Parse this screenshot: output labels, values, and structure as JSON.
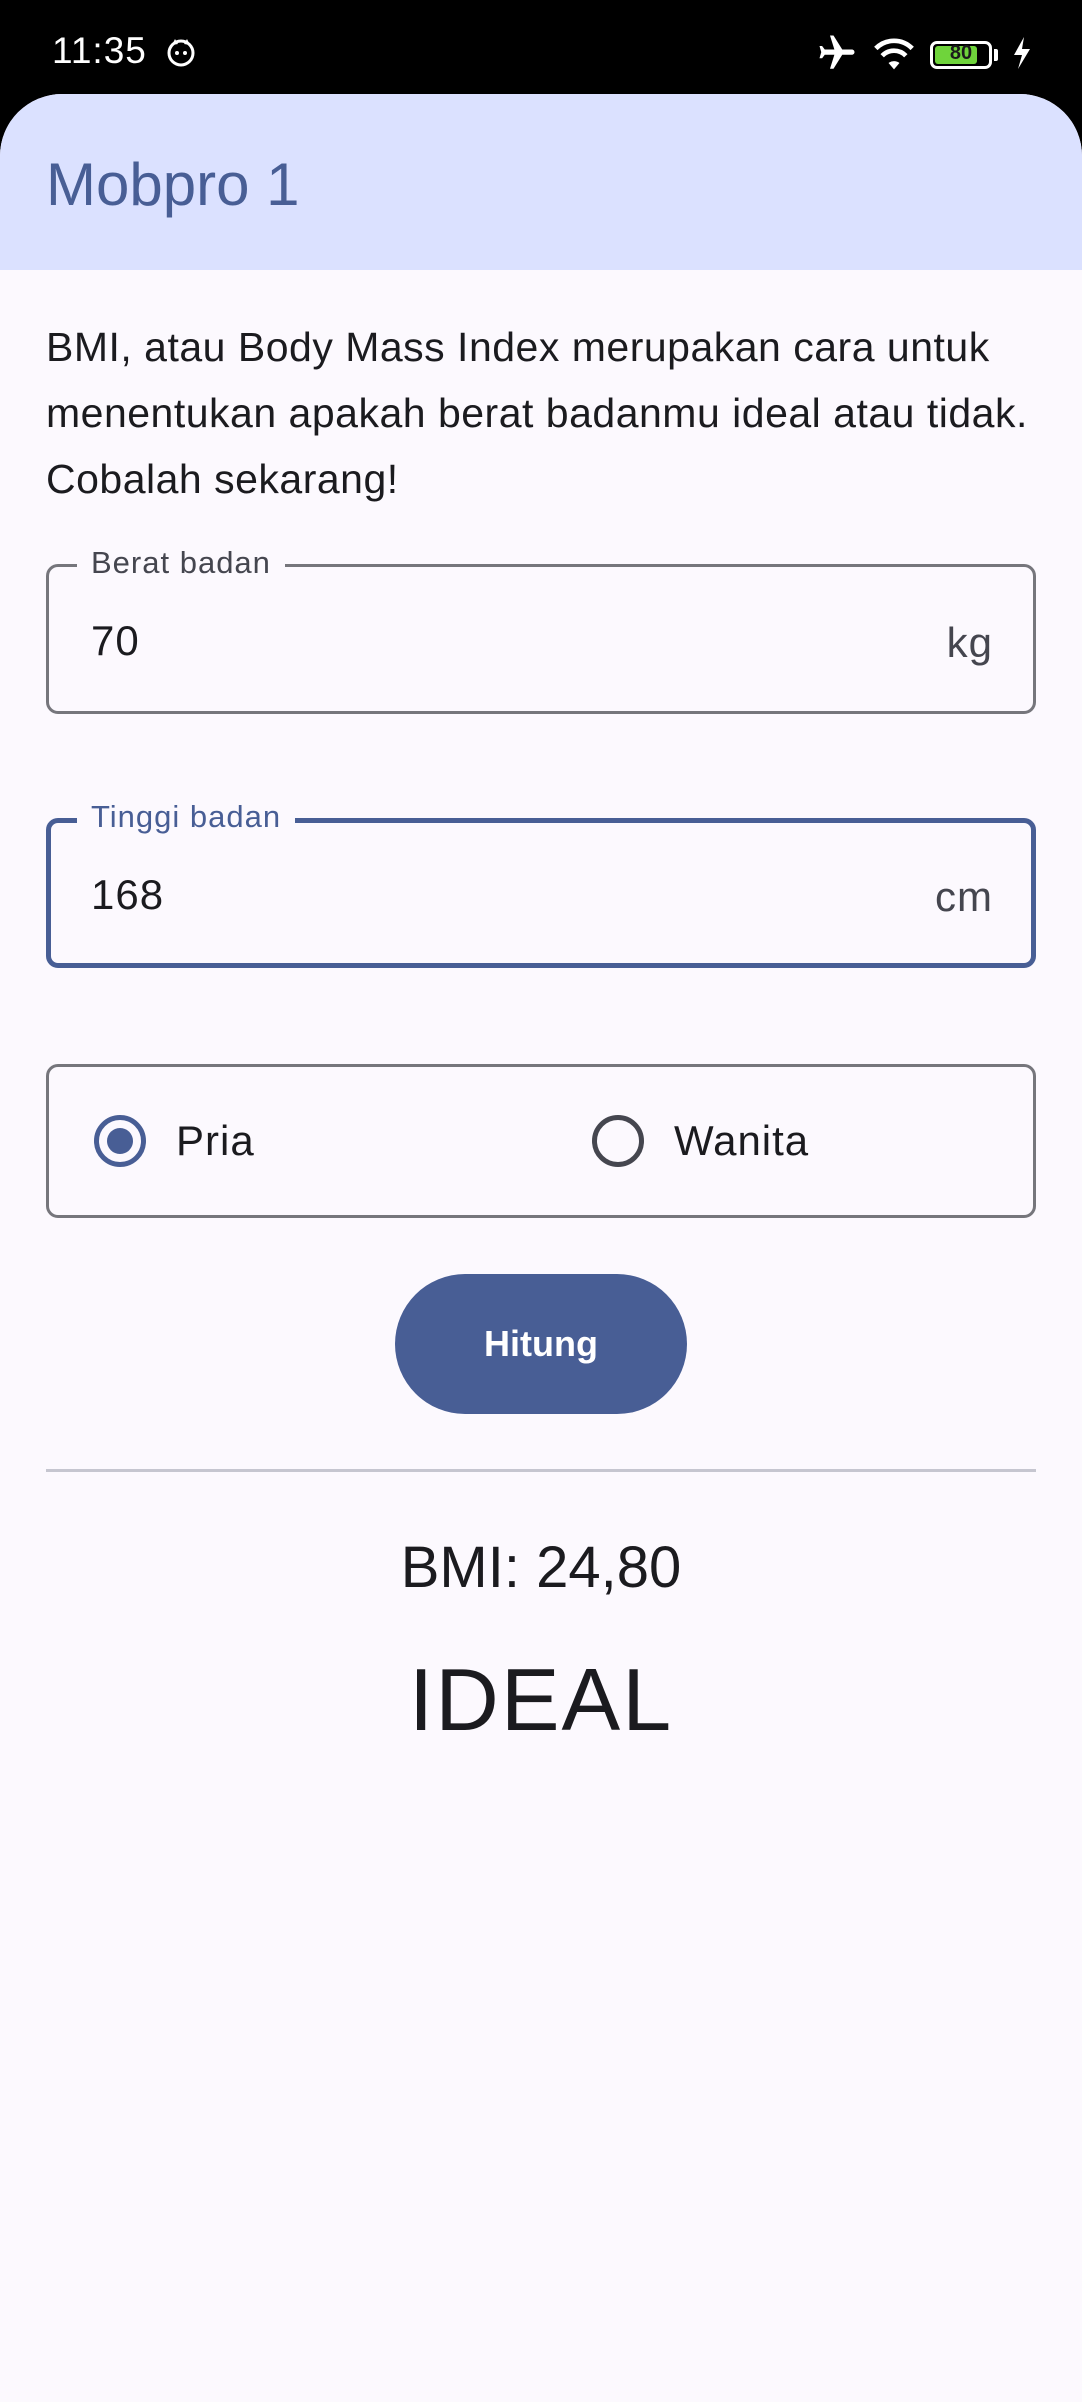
{
  "status_bar": {
    "time": "11:35",
    "battery_level": "80",
    "battery_fraction": 0.8,
    "icons": [
      "cat-notification-icon",
      "airplane-mode-icon",
      "wifi-icon",
      "battery-icon",
      "charging-bolt-icon"
    ]
  },
  "app_bar": {
    "title": "Mobpro 1"
  },
  "intro": "BMI, atau Body Mass Index merupakan cara untuk menentukan apakah berat badanmu ideal atau tidak. Cobalah sekarang!",
  "weight_field": {
    "label": "Berat badan",
    "value": "70",
    "suffix": "kg"
  },
  "height_field": {
    "label": "Tinggi badan",
    "value": "168",
    "suffix": "cm",
    "focused": true
  },
  "gender": {
    "options": [
      {
        "label": "Pria",
        "selected": true
      },
      {
        "label": "Wanita",
        "selected": false
      }
    ]
  },
  "calculate_button": {
    "label": "Hitung"
  },
  "result": {
    "bmi_text": "BMI: 24,80",
    "category": "IDEAL"
  },
  "nav_bar": {
    "icons": [
      "recents-square-icon",
      "home-circle-icon",
      "back-triangle-icon"
    ]
  },
  "colors": {
    "primary": "#485e95",
    "app_bar_bg": "#dbe1ff",
    "surface": "#fcf9fe",
    "outline": "#76767c",
    "battery_green": "#6fd43b"
  }
}
